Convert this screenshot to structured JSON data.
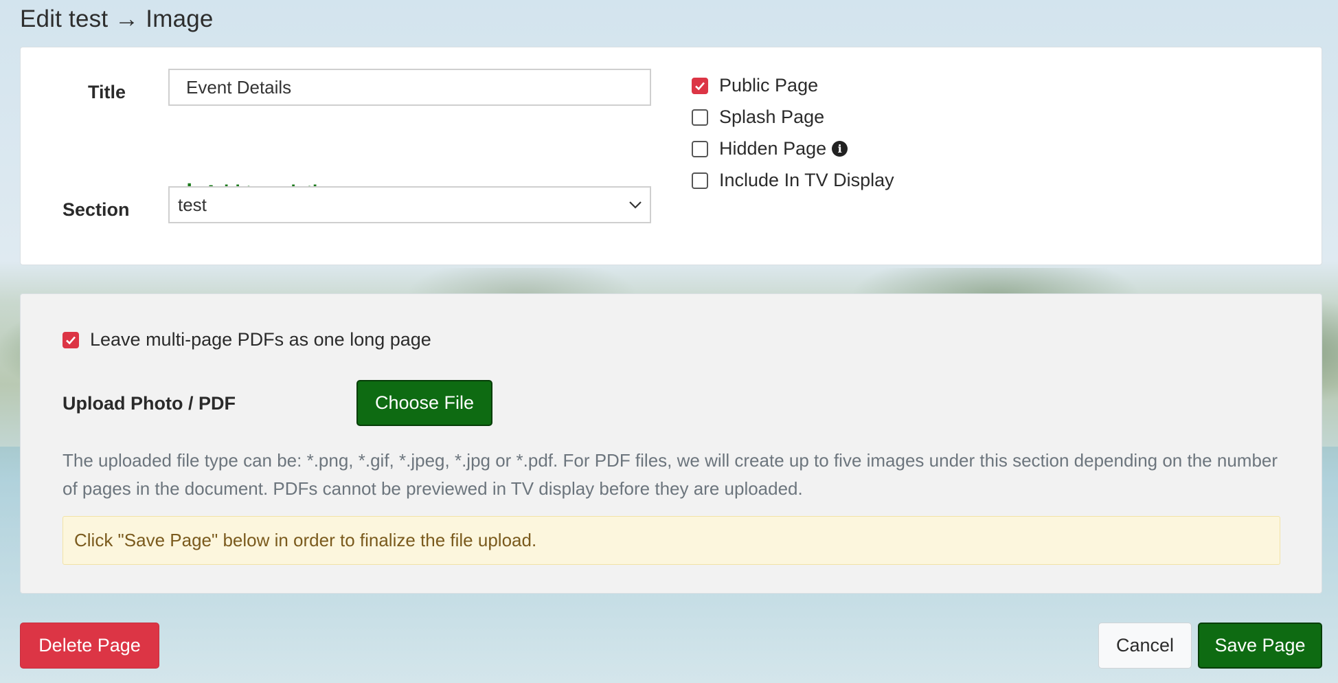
{
  "header": {
    "title": "Edit test → Image"
  },
  "details": {
    "title_label": "Title",
    "title_value": "Event Details",
    "add_translation": "Add translation",
    "section_label": "Section",
    "section_value": "test",
    "options": [
      {
        "label": "Public Page",
        "checked": true
      },
      {
        "label": "Splash Page",
        "checked": false
      },
      {
        "label": "Hidden Page",
        "checked": false,
        "info_icon": "info-icon"
      },
      {
        "label": "Include In TV Display",
        "checked": false
      }
    ]
  },
  "upload": {
    "multipage_label": "Leave multi-page PDFs as one long page",
    "multipage_checked": true,
    "upload_label": "Upload Photo / PDF",
    "choose_file": "Choose File",
    "help_text": "The uploaded file type can be: *.png, *.gif, *.jpeg, *.jpg or *.pdf. For PDF files, we will create up to five images under this section depending on the number of pages in the document. PDFs cannot be previewed in TV display before they are uploaded.",
    "notice": "Click \"Save Page\" below in order to finalize the file upload."
  },
  "footer": {
    "delete": "Delete Page",
    "cancel": "Cancel",
    "save": "Save Page"
  },
  "colors": {
    "primary_green": "#0e6b12",
    "danger_red": "#dc3545",
    "link_green": "#1b7a1b",
    "notice_bg": "#fcf6dd"
  }
}
